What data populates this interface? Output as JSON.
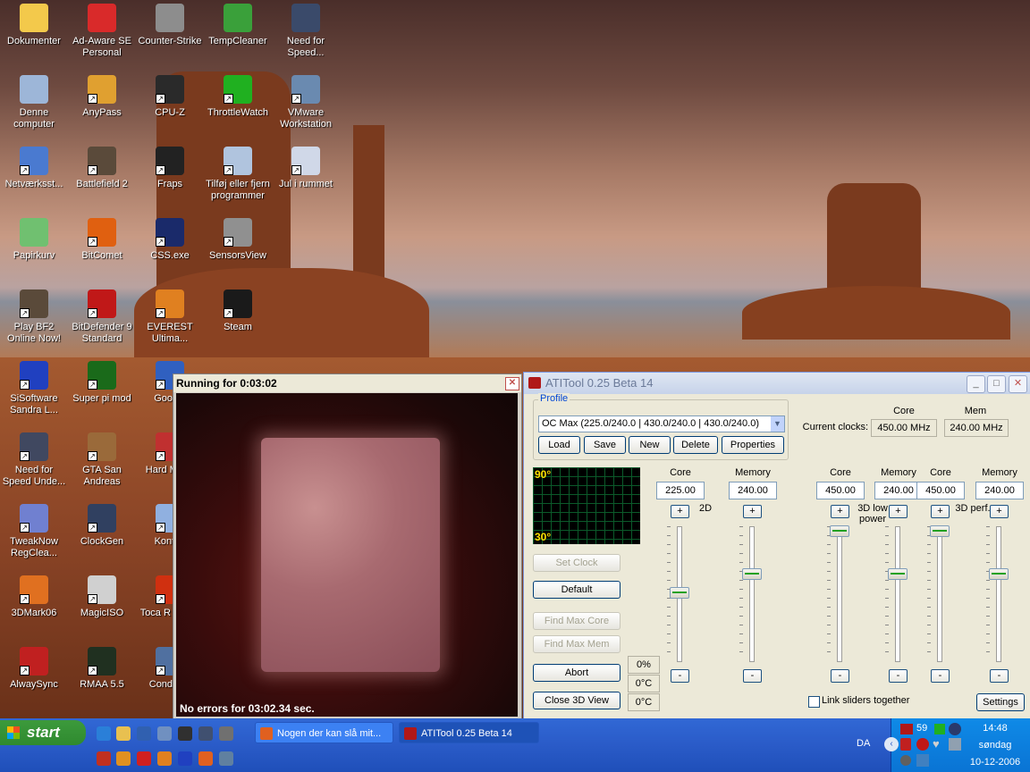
{
  "desktop": {
    "icons": [
      {
        "label": "Dokumenter",
        "color": "#f3c94b"
      },
      {
        "label": "Ad-Aware SE Personal",
        "color": "#d92a2a"
      },
      {
        "label": "Counter-Strike",
        "color": "#8d8d8d"
      },
      {
        "label": "TempCleaner",
        "color": "#3aa03a"
      },
      {
        "label": "Need for Speed...",
        "color": "#3a4a6a"
      },
      {
        "label": "Denne computer",
        "color": "#9db6d8"
      },
      {
        "label": "AnyPass",
        "color": "#e0a030"
      },
      {
        "label": "CPU-Z",
        "color": "#2a2a2a"
      },
      {
        "label": "ThrottleWatch",
        "color": "#20b020"
      },
      {
        "label": "VMware Workstation",
        "color": "#6a8ab0"
      },
      {
        "label": "Netværksst...",
        "color": "#4a7ad0"
      },
      {
        "label": "Battlefield 2",
        "color": "#5a4a3a"
      },
      {
        "label": "Fraps",
        "color": "#222222"
      },
      {
        "label": "Tilføj eller fjern programmer",
        "color": "#b0c4de"
      },
      {
        "label": "Jul i rummet",
        "color": "#d0d8e8"
      },
      {
        "label": "Papirkurv",
        "color": "#70c070"
      },
      {
        "label": "BitComet",
        "color": "#e06010"
      },
      {
        "label": "CSS.exe",
        "color": "#1a2a6a"
      },
      {
        "label": "SensorsView",
        "color": "#909090"
      },
      {
        "label": "Play BF2 Online Now!",
        "color": "#5a4a3a"
      },
      {
        "label": "BitDefender 9 Standard",
        "color": "#c01818"
      },
      {
        "label": "EVEREST Ultima...",
        "color": "#e08020"
      },
      {
        "label": "Steam",
        "color": "#1a1a1a"
      },
      {
        "label": "SiSoftware Sandra L...",
        "color": "#2040c0"
      },
      {
        "label": "Super pi mod",
        "color": "#1a6a1a"
      },
      {
        "label": "Google",
        "color": "#3060c0"
      },
      {
        "label": "Need for Speed Unde...",
        "color": "#404860"
      },
      {
        "label": "GTA San Andreas",
        "color": "#9a6a3a"
      },
      {
        "label": "Hard Mana",
        "color": "#c03030"
      },
      {
        "label": "TweakNow RegClea...",
        "color": "#7080d0"
      },
      {
        "label": "ClockGen",
        "color": "#304060"
      },
      {
        "label": "Kontrol",
        "color": "#90b0e0"
      },
      {
        "label": "3DMark06",
        "color": "#e07020"
      },
      {
        "label": "MagicISO",
        "color": "#d0d0d0"
      },
      {
        "label": "Toca R Driver",
        "color": "#d03010"
      },
      {
        "label": "AlwaySync",
        "color": "#c02020"
      },
      {
        "label": "RMAA 5.5",
        "color": "#203020"
      },
      {
        "label": "Condition",
        "color": "#5070a0"
      }
    ]
  },
  "window3d": {
    "title": "Running for 0:03:02",
    "status": "No errors for 03:02.34 sec."
  },
  "atitool": {
    "title": "ATITool 0.25 Beta 14",
    "profile_legend": "Profile",
    "profile_value": "OC Max (225.0/240.0 | 430.0/240.0 | 430.0/240.0)",
    "buttons": {
      "load": "Load",
      "save": "Save",
      "new": "New",
      "delete": "Delete",
      "properties": "Properties"
    },
    "current_clocks_label": "Current clocks:",
    "core_header": "Core",
    "mem_header": "Mem",
    "current_core": "450.00 MHz",
    "current_mem": "240.00 MHz",
    "graph": {
      "top": "90°",
      "bottom": "30°"
    },
    "actions": {
      "set_clock": "Set Clock",
      "default": "Default",
      "find_max_core": "Find Max Core",
      "find_max_mem": "Find Max Mem",
      "abort": "Abort",
      "close_3d": "Close 3D View"
    },
    "readouts": [
      "0%",
      "0°C",
      "0°C"
    ],
    "columns": [
      {
        "core_label": "Core",
        "mem_label": "Memory",
        "core": "225.00",
        "mem": "240.00",
        "mode": "2D",
        "core_level": 0.48,
        "mem_level": 0.34
      },
      {
        "core_label": "Core",
        "mem_label": "Memory",
        "core": "450.00",
        "mode": "3D low power",
        "mem": "240.00",
        "core_level": 0.02,
        "mem_level": 0.34
      },
      {
        "core_label": "Core",
        "mem_label": "Memory",
        "core": "450.00",
        "mode": "3D perf.",
        "mem": "240.00",
        "core_level": 0.02,
        "mem_level": 0.34
      }
    ],
    "link_sliders": "Link sliders together",
    "settings": "Settings",
    "plus": "+",
    "minus": "-"
  },
  "taskbar": {
    "start": "start",
    "tasks": [
      "Nogen der kan slå mit...",
      "ATITool 0.25 Beta 14"
    ],
    "lang": "DA",
    "tray_number": "59",
    "time": "14:48",
    "day": "søndag",
    "date": "10-12-2006"
  }
}
